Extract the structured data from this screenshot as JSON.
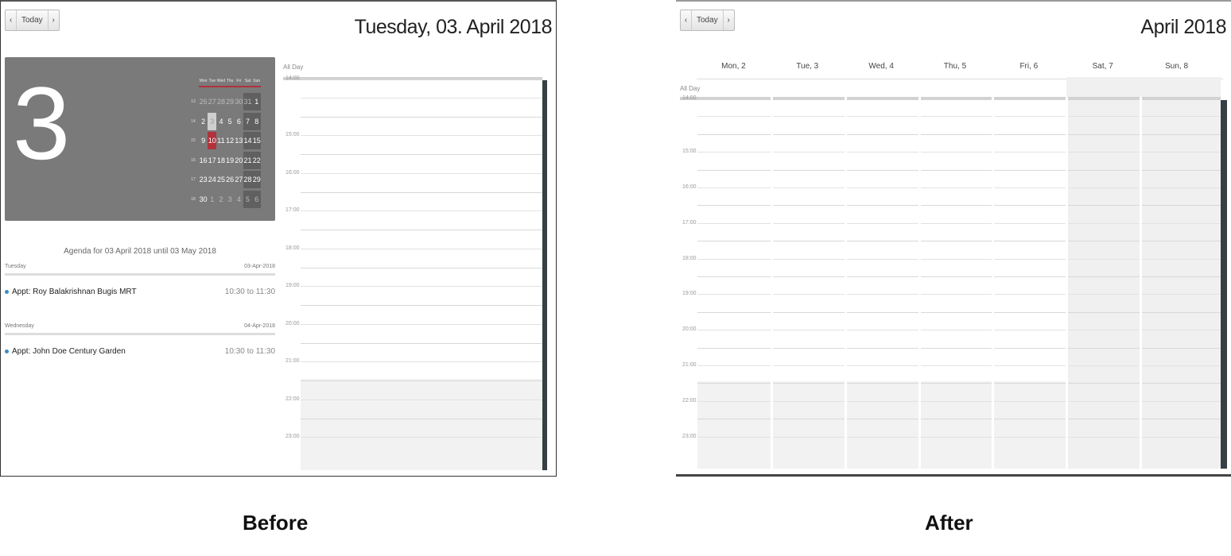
{
  "before": {
    "nav": {
      "prev": "‹",
      "today": "Today",
      "next": "›"
    },
    "title": "Tuesday, 03. April 2018",
    "big_day": "3",
    "mini_calendar": {
      "weekdays": [
        "Mon",
        "Tue",
        "Wed",
        "Thu",
        "Fri",
        "Sat",
        "Sun"
      ],
      "weeks": [
        {
          "wk": "13",
          "days": [
            "26",
            "27",
            "28",
            "29",
            "30",
            "31",
            "1"
          ]
        },
        {
          "wk": "14",
          "days": [
            "2",
            "3",
            "4",
            "5",
            "6",
            "7",
            "8"
          ]
        },
        {
          "wk": "15",
          "days": [
            "9",
            "10",
            "11",
            "12",
            "13",
            "14",
            "15"
          ]
        },
        {
          "wk": "16",
          "days": [
            "16",
            "17",
            "18",
            "19",
            "20",
            "21",
            "22"
          ]
        },
        {
          "wk": "17",
          "days": [
            "23",
            "24",
            "25",
            "26",
            "27",
            "28",
            "29"
          ]
        },
        {
          "wk": "18",
          "days": [
            "30",
            "1",
            "2",
            "3",
            "4",
            "5",
            "6"
          ]
        }
      ]
    },
    "agenda": {
      "title": "Agenda for 03 April 2018 until 03 May 2018",
      "days": [
        {
          "weekday": "Tuesday",
          "date": "03-Apr-2018",
          "item": "Appt: Roy Balakrishnan Bugis MRT",
          "time": "10:30 to 11:30"
        },
        {
          "weekday": "Wednesday",
          "date": "04-Apr-2018",
          "item": "Appt: John Doe Century Garden",
          "time": "10:30 to 11:30"
        }
      ]
    },
    "allday_label": "All Day",
    "hours": [
      "14:00",
      "15:00",
      "16:00",
      "17:00",
      "18:00",
      "19:00",
      "20:00",
      "21:00",
      "22:00",
      "23:00"
    ]
  },
  "after": {
    "nav": {
      "prev": "‹",
      "today": "Today",
      "next": "›"
    },
    "title": "April 2018",
    "columns": [
      "Mon, 2",
      "Tue, 3",
      "Wed, 4",
      "Thu, 5",
      "Fri, 6",
      "Sat, 7",
      "Sun, 8"
    ],
    "allday_label": "All Day",
    "hours": [
      "14:00",
      "15:00",
      "16:00",
      "17:00",
      "18:00",
      "19:00",
      "20:00",
      "21:00",
      "22:00",
      "23:00"
    ]
  },
  "captions": {
    "before": "Before",
    "after": "After"
  },
  "colors": {
    "accent": "#b2323c",
    "block": "#7a7a7a",
    "event_dot": "#3a8cc4",
    "scrollbar": "#364044"
  }
}
